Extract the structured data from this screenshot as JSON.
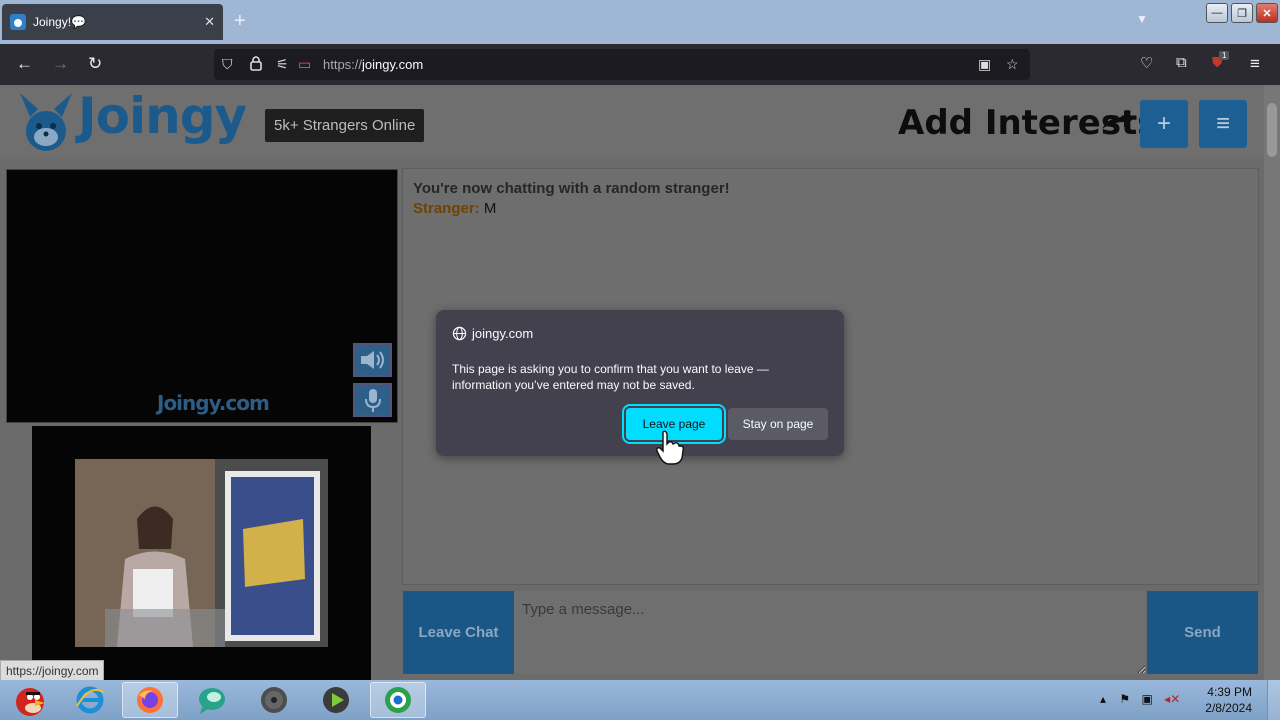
{
  "browser": {
    "tab_title": "Joingy!💬",
    "tab_close": "✕",
    "new_tab": "+",
    "url_scheme": "https://",
    "url_host": "joingy.com",
    "ext_badge": "1"
  },
  "header": {
    "logo_text": "Joingy",
    "online_badge": "5k+ Strangers Online",
    "add_interests": "Add Interests",
    "plus_label": "+",
    "menu_label": "≡"
  },
  "video": {
    "watermark": "Joingy.com"
  },
  "chat": {
    "system_message": "You're now chatting with a random stranger!",
    "messages": [
      {
        "sender": "Stranger:",
        "text": "M"
      }
    ],
    "leave_label": "Leave Chat",
    "input_placeholder": "Type a message...",
    "send_label": "Send"
  },
  "dialog": {
    "host": "joingy.com",
    "message": "This page is asking you to confirm that you want to leave — information you’ve entered may not be saved.",
    "leave_button": "Leave page",
    "stay_button": "Stay on page"
  },
  "status_bar": {
    "link": "https://joingy.com"
  },
  "taskbar": {
    "time": "4:39 PM",
    "date": "2/8/2024"
  },
  "colors": {
    "joingy_blue": "#1d5f93",
    "dialog_bg": "#42414d",
    "dialog_primary": "#00ddff",
    "stranger_label": "#704300"
  }
}
